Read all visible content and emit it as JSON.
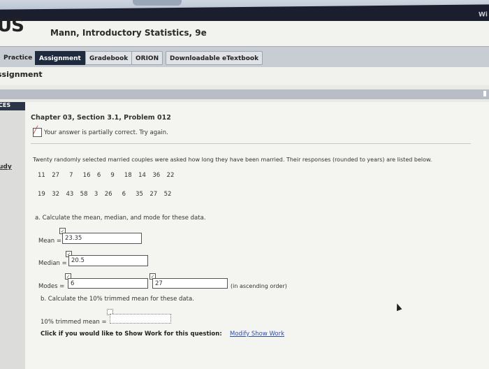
{
  "app": {
    "logo": "US",
    "corner_text": "Wi",
    "book_title": "Mann, Introductory Statistics, 9e"
  },
  "nav": {
    "items": [
      "Practice",
      "Assignment",
      "Gradebook",
      "ORION",
      "Downloadable eTextbook"
    ]
  },
  "section": {
    "title": "ssignment"
  },
  "sidebar": {
    "top_label": "CES",
    "link": "udy"
  },
  "problem": {
    "title": "Chapter 03, Section 3.1, Problem 012",
    "status": "Your answer is partially correct.  Try again.",
    "question": "Twenty randomly selected married couples were asked how long they have been married. Their responses (rounded to years) are listed below.",
    "data_row1": "11  27   7   16  6   9   18  14  36  22",
    "data_row2": "19  32  43  58  3  26   6   35  27  52",
    "part_a": "a. Calculate the mean, median, and mode for these data.",
    "mean_label": "Mean =",
    "mean_value": "23.35",
    "median_label": "Median =",
    "median_value": "20.5",
    "modes_label": "Modes =",
    "mode1_value": "6",
    "mode2_value": "27",
    "modes_note": "(in ascending order)",
    "part_b": "b. Calculate the 10% trimmed mean for these data.",
    "trimmed_label": "10% trimmed mean =",
    "trimmed_value": "",
    "show_work_prompt": "Click if you would like to Show Work for this question:",
    "show_work_link": "Modify Show Work"
  },
  "colors": {
    "nav_active": "#1e2b3f",
    "link": "#2f4fb0",
    "status_mark": "#cc3333"
  }
}
